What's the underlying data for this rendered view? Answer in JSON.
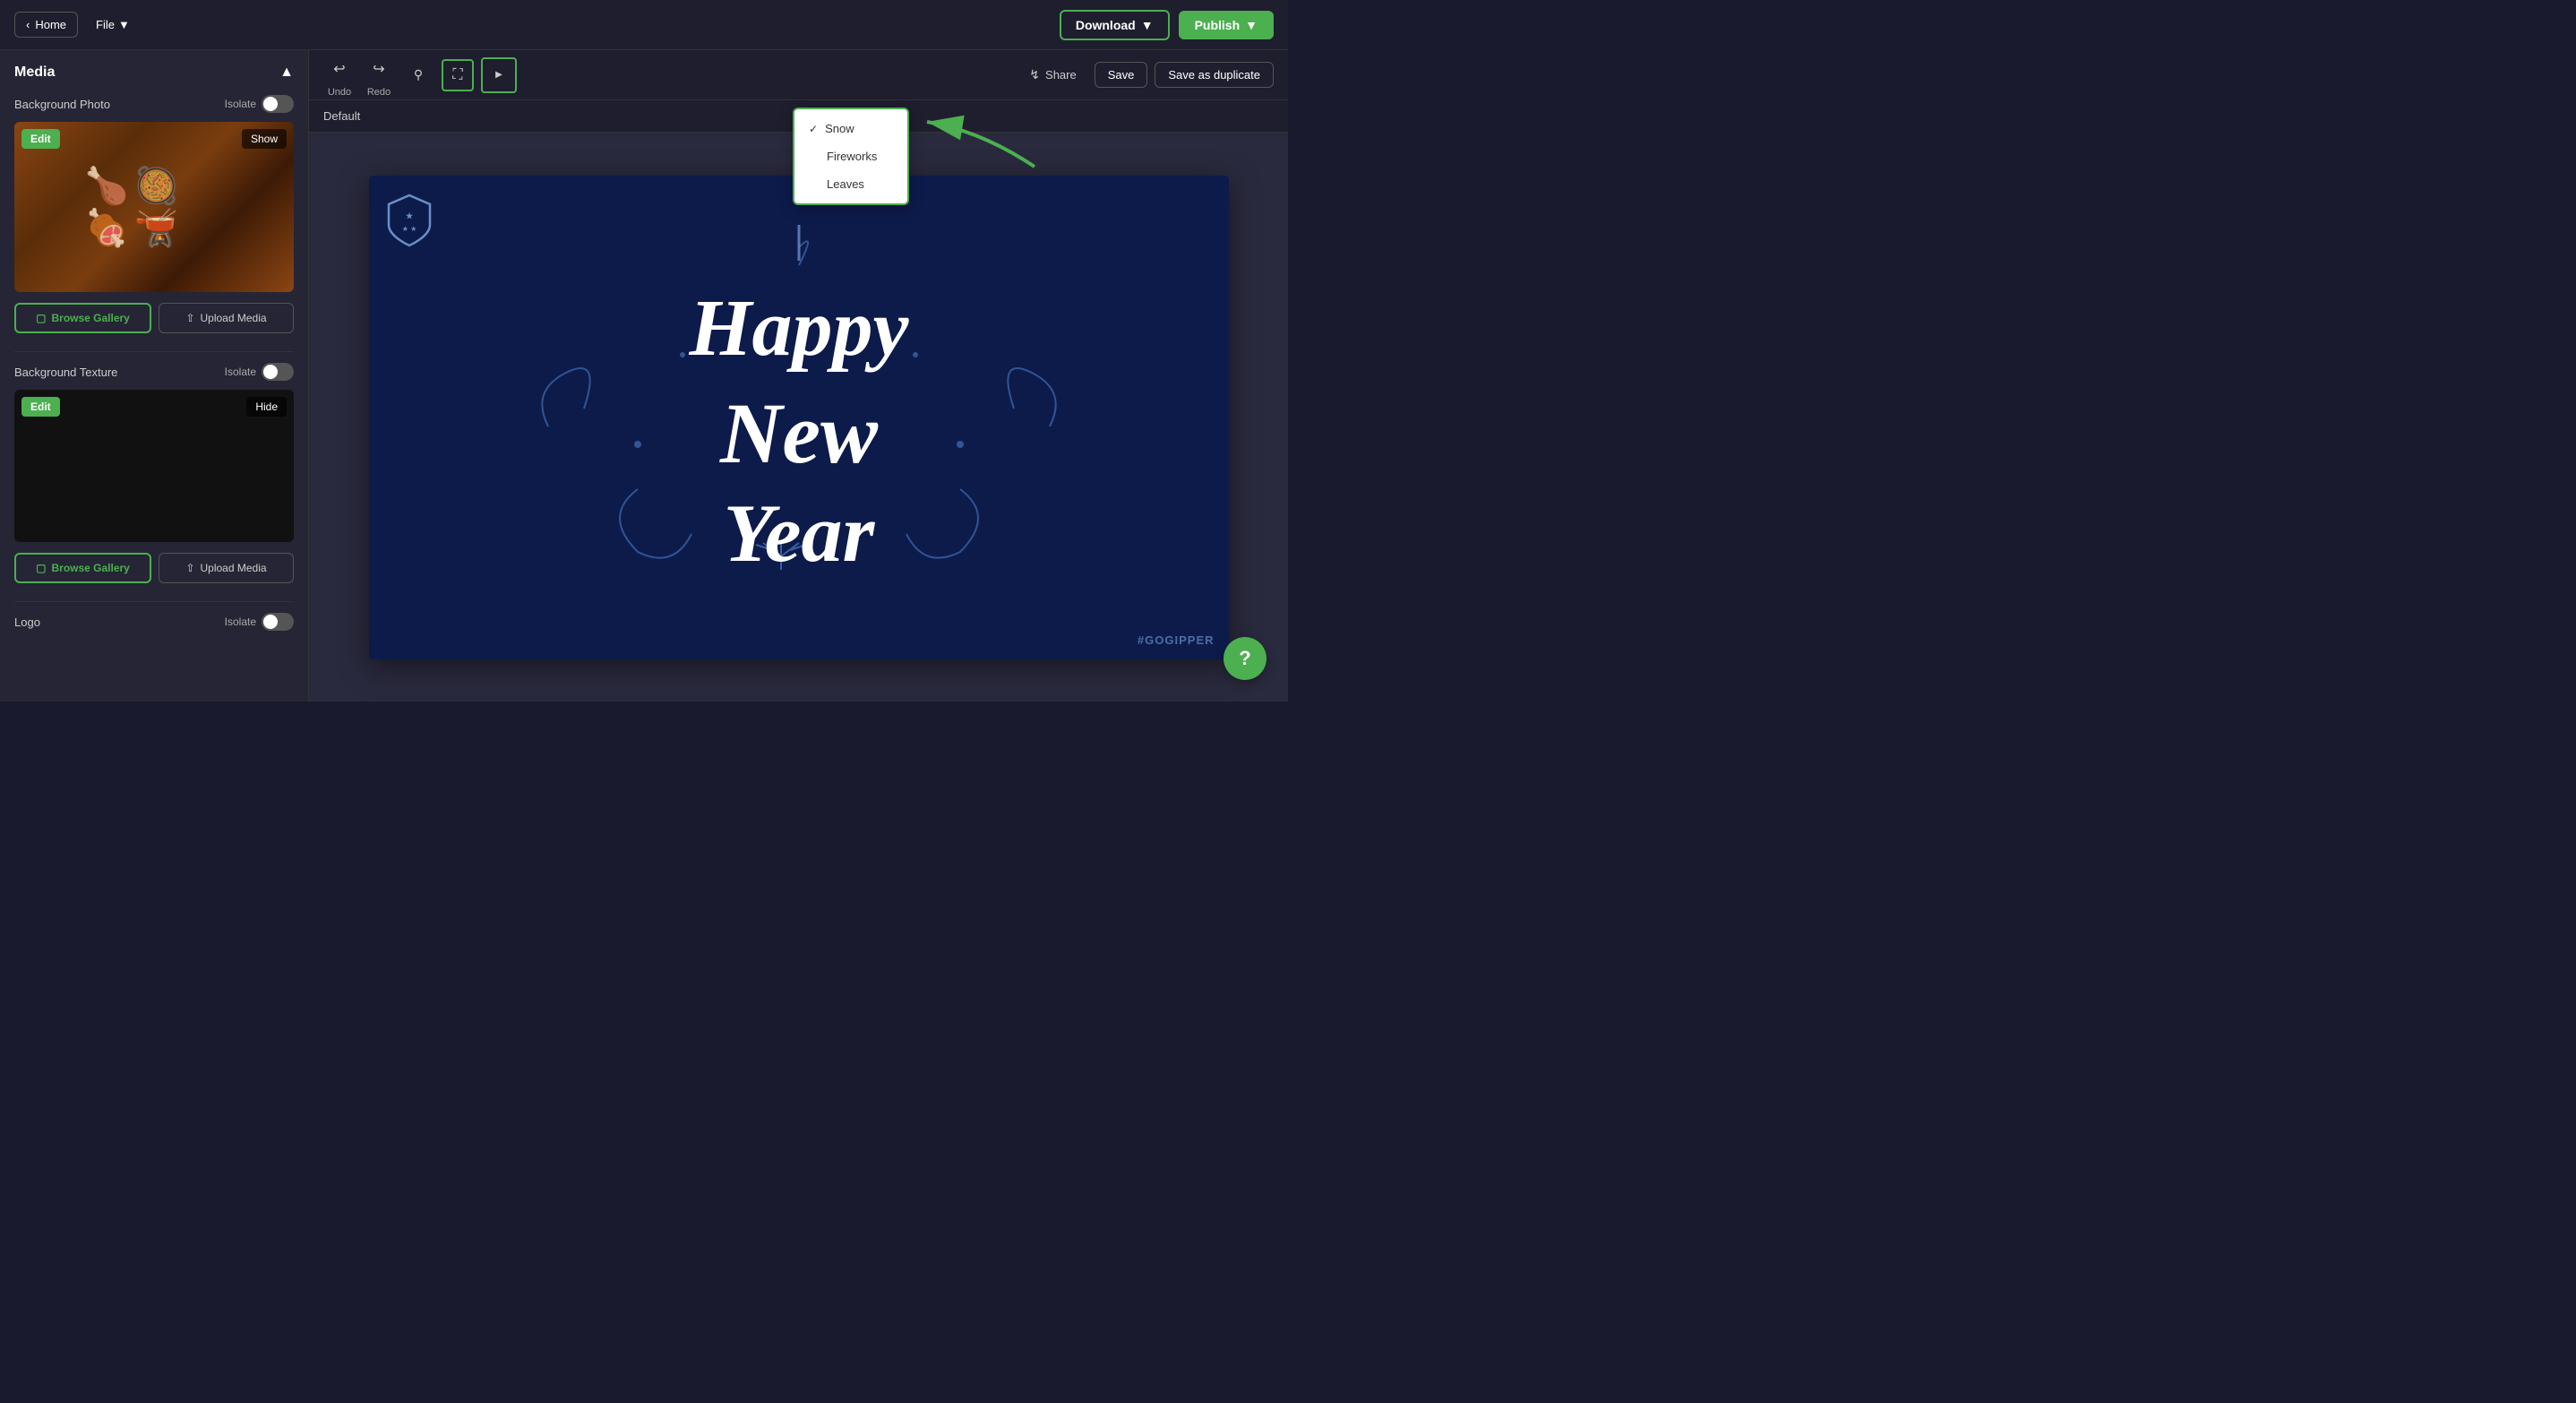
{
  "topbar": {
    "home_label": "Home",
    "file_label": "File",
    "download_label": "Download",
    "publish_label": "Publish"
  },
  "toolbar": {
    "undo_label": "Undo",
    "redo_label": "Redo",
    "share_label": "Share",
    "save_label": "Save",
    "save_duplicate_label": "Save as duplicate",
    "default_label": "Default"
  },
  "sidebar": {
    "title": "Media",
    "background_photo_label": "Background Photo",
    "isolate_label_1": "Isolate",
    "edit_label_1": "Edit",
    "show_label": "Show",
    "browse_gallery_label_1": "Browse Gallery",
    "upload_media_label_1": "Upload Media",
    "background_texture_label": "Background Texture",
    "isolate_label_2": "Isolate",
    "edit_label_2": "Edit",
    "hide_label": "Hide",
    "browse_gallery_label_2": "Browse Gallery",
    "upload_media_label_2": "Upload Media",
    "logo_label": "Logo",
    "isolate_label_3": "Isolate"
  },
  "dropdown": {
    "items": [
      {
        "label": "Snow",
        "checked": true
      },
      {
        "label": "Fireworks",
        "checked": false
      },
      {
        "label": "Leaves",
        "checked": false
      }
    ]
  },
  "canvas": {
    "watermark": "#GOGIPPER",
    "happy_text": "Happy",
    "new_text": "New",
    "year_text": "Year"
  },
  "help_btn_label": "?"
}
